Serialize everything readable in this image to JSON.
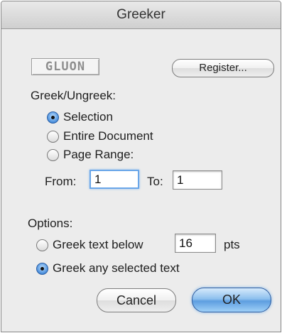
{
  "window": {
    "title": "Greeker"
  },
  "logo": {
    "text": "GLUON"
  },
  "register": {
    "label": "Register..."
  },
  "greek_section": {
    "heading": "Greek/Ungreek:",
    "options": [
      {
        "label": "Selection",
        "selected": true
      },
      {
        "label": "Entire Document",
        "selected": false
      },
      {
        "label": "Page Range:",
        "selected": false
      }
    ],
    "from_label": "From:",
    "from_value": "1",
    "to_label": "To:",
    "to_value": "1"
  },
  "options_section": {
    "heading": "Options:",
    "below_label": "Greek text below",
    "below_value": "16",
    "below_unit": "pts",
    "below_selected": false,
    "any_label": "Greek any selected text",
    "any_selected": true
  },
  "buttons": {
    "cancel": "Cancel",
    "ok": "OK"
  },
  "colors": {
    "default_button": "#5d9ee0",
    "window_bg": "#ececec"
  }
}
